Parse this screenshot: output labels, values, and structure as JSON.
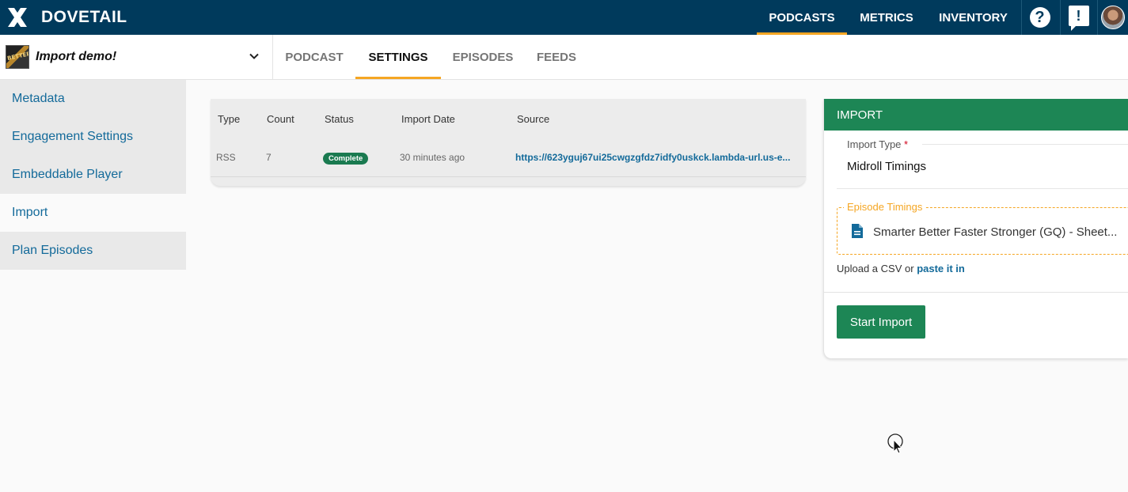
{
  "brand": {
    "name": "DOVETAIL"
  },
  "topnav": {
    "items": [
      {
        "label": "PODCASTS",
        "active": true
      },
      {
        "label": "METRICS",
        "active": false
      },
      {
        "label": "INVENTORY",
        "active": false
      }
    ],
    "help_icon": "question-circle-icon",
    "feedback_icon": "feedback-icon"
  },
  "podcast": {
    "name": "Import demo!",
    "thumbnail_text": "BETTER"
  },
  "subtabs": [
    {
      "label": "PODCAST",
      "active": false
    },
    {
      "label": "SETTINGS",
      "active": true
    },
    {
      "label": "EPISODES",
      "active": false
    },
    {
      "label": "FEEDS",
      "active": false
    }
  ],
  "sidebar": {
    "items": [
      {
        "label": "Metadata",
        "active": false
      },
      {
        "label": "Engagement Settings",
        "active": false
      },
      {
        "label": "Embeddable Player",
        "active": false
      },
      {
        "label": "Import",
        "active": true
      },
      {
        "label": "Plan Episodes",
        "active": false
      }
    ]
  },
  "imports_table": {
    "headers": [
      "Type",
      "Count",
      "Status",
      "Import Date",
      "Source"
    ],
    "rows": [
      {
        "type": "RSS",
        "count": "7",
        "status": "Complete",
        "date": "30 minutes ago",
        "source": "https://623yguj67ui25cwgzgfdz7idfy0uskck.lambda-url.us-e..."
      }
    ]
  },
  "import_panel": {
    "title": "IMPORT",
    "import_type_label": "Import Type",
    "required_marker": "*",
    "import_type_value": "Midroll Timings",
    "episode_timings_label": "Episode Timings",
    "file_name": "Smarter Better Faster Stronger (GQ) - Sheet...",
    "upload_prefix": "Upload a CSV or",
    "paste_link": "paste it in",
    "start_button": "Start Import"
  },
  "colors": {
    "navbar": "#003a5c",
    "accent": "#f5a623",
    "primary_green": "#1d8655",
    "link_blue": "#136a9a"
  }
}
